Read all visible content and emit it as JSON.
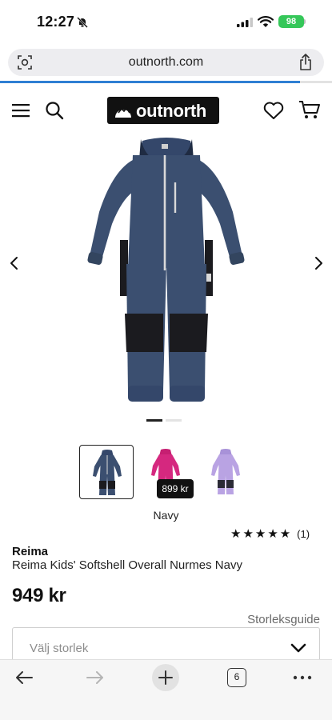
{
  "status_bar": {
    "time": "12:27",
    "battery": "98"
  },
  "browser": {
    "url": "outnorth.com",
    "tab_count": "6"
  },
  "site": {
    "logo_text": "outnorth"
  },
  "product": {
    "brand": "Reima",
    "title": "Reima Kids' Softshell Overall Nurmes Navy",
    "price": "949 kr",
    "color_name": "Navy",
    "rating_stars": "★★★★★",
    "rating_count": "(1)",
    "size_guide_label": "Storleksguide",
    "size_placeholder": "Välj storlek",
    "image_count": 2,
    "active_image": 1,
    "variants": [
      {
        "name": "navy",
        "color": "#3b4f70",
        "selected": true
      },
      {
        "name": "pink",
        "color": "#d5287f",
        "price": "899 kr"
      },
      {
        "name": "lilac",
        "color": "#b9a3e3"
      }
    ]
  },
  "colors": {
    "accent": "#2f7fd3",
    "battery": "#35c759",
    "navy": "#3b4f70",
    "patch": "#1b1b1f"
  }
}
